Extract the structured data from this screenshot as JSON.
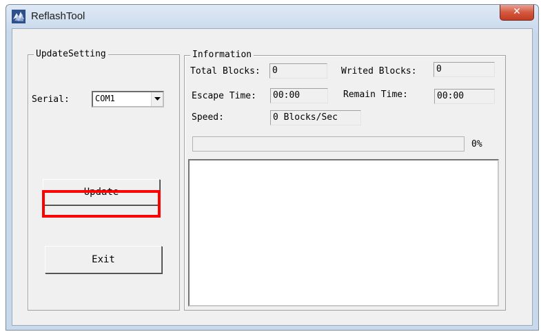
{
  "window": {
    "title": "ReflashTool",
    "close_symbol": "✕"
  },
  "update_setting": {
    "group_label": "UpdateSetting",
    "serial_label": "Serial:",
    "serial_value": "COM1",
    "update_label": "Update",
    "exit_label": "Exit"
  },
  "information": {
    "group_label": "Information",
    "total_blocks_label": "Total Blocks:",
    "total_blocks_value": "0",
    "writed_blocks_label": "Writed Blocks:",
    "writed_blocks_value": "0",
    "escape_time_label": "Escape Time:",
    "escape_time_value": "00:00",
    "remain_time_label": "Remain Time:",
    "remain_time_value": "00:00",
    "speed_label": "Speed:",
    "speed_value": "0 Blocks/Sec",
    "progress_text": "0%",
    "progress_fraction": 0
  },
  "colors": {
    "highlight": "#ff0000",
    "close_button": "#c9452b"
  }
}
